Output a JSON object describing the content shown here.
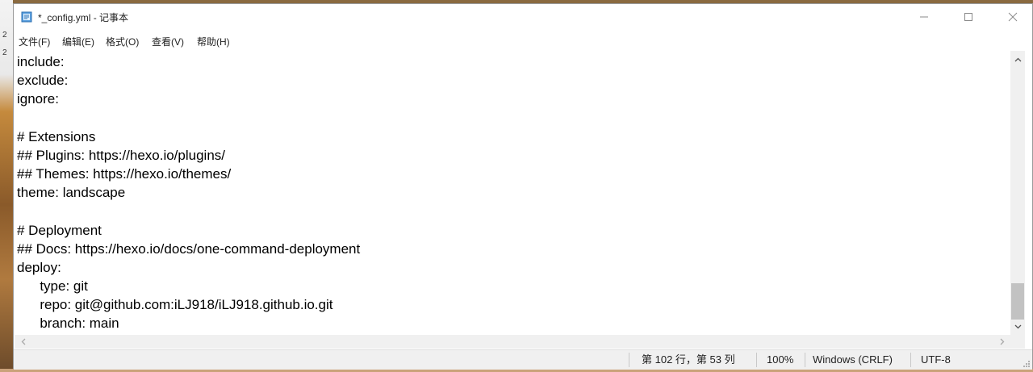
{
  "desktop": {
    "left_numbers": [
      "2",
      "2"
    ]
  },
  "window": {
    "title": "*_config.yml - 记事本",
    "controls": {
      "minimize": "minimize-icon",
      "maximize": "maximize-icon",
      "close": "close-icon"
    }
  },
  "menu": [
    "文件(F)",
    "编辑(E)",
    "格式(O)",
    "查看(V)",
    "帮助(H)"
  ],
  "editor": {
    "lines": [
      "include:",
      "exclude:",
      "ignore:",
      "",
      "# Extensions",
      "## Plugins: https://hexo.io/plugins/",
      "## Themes: https://hexo.io/themes/",
      "theme: landscape",
      "",
      "# Deployment",
      "## Docs: https://hexo.io/docs/one-command-deployment",
      "deploy:",
      "      type: git",
      "      repo: git@github.com:iLJ918/iLJ918.github.io.git",
      "      branch: main"
    ]
  },
  "status": {
    "position": "第 102 行，第 53 列",
    "zoom": "100%",
    "line_ending": "Windows (CRLF)",
    "encoding": "UTF-8"
  },
  "colors": {
    "window_bg": "#ffffff",
    "statusbar_bg": "#f0f0f0",
    "scroll_thumb": "#c2c2c2"
  }
}
